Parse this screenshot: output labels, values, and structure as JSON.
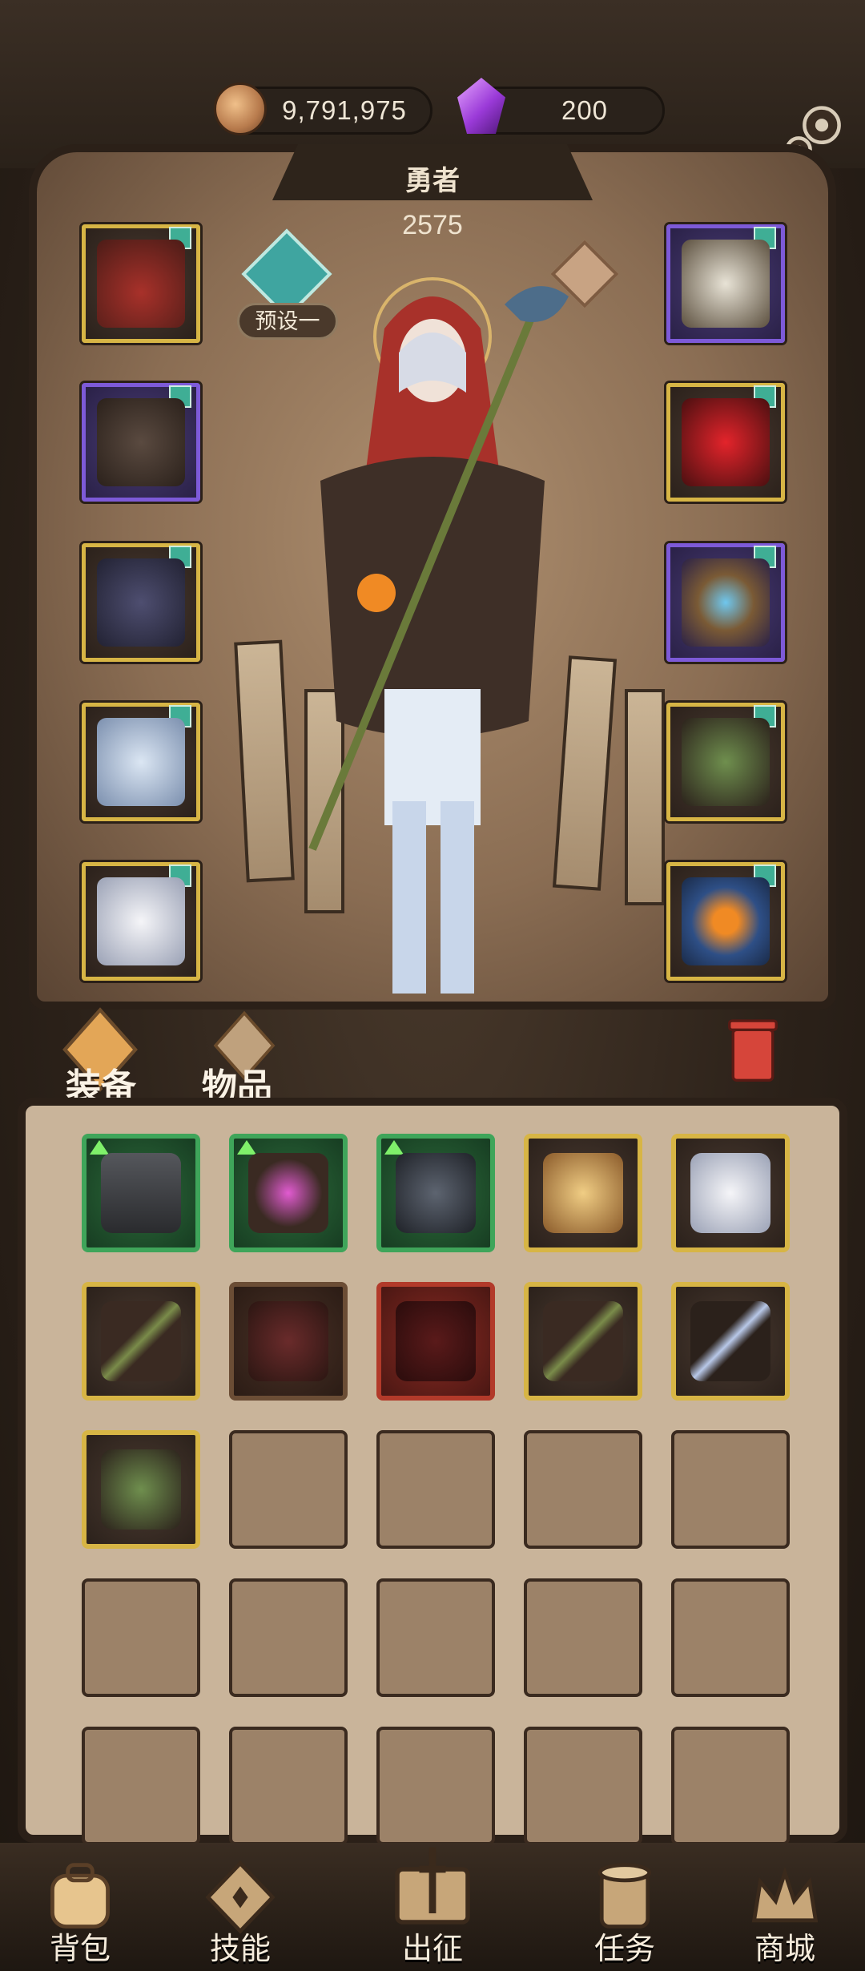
{
  "currency": {
    "gold": "9,791,975",
    "gems": "200"
  },
  "hero": {
    "name": "勇者",
    "power": "2575",
    "preset_label": "预设一"
  },
  "tabs": [
    {
      "label": "装备"
    },
    {
      "label": "物品"
    }
  ],
  "nav": [
    {
      "label": "背包",
      "icon": "backpack-icon"
    },
    {
      "label": "技能",
      "icon": "skill-book-icon"
    },
    {
      "label": "出征",
      "icon": "expedition-map-icon"
    },
    {
      "label": "任务",
      "icon": "quest-scroll-icon"
    },
    {
      "label": "商城",
      "icon": "shop-crown-icon"
    }
  ],
  "equipment_left": [
    {
      "name": "red-cloak-hood",
      "rarity": "gold"
    },
    {
      "name": "fur-mantle",
      "rarity": "purple"
    },
    {
      "name": "dark-gauntlet",
      "rarity": "gold"
    },
    {
      "name": "white-skirt",
      "rarity": "gold"
    },
    {
      "name": "winged-boots",
      "rarity": "gold"
    }
  ],
  "equipment_right": [
    {
      "name": "shield-amulet",
      "rarity": "purple"
    },
    {
      "name": "crimson-helm",
      "rarity": "gold"
    },
    {
      "name": "blue-gem-ring",
      "rarity": "purple"
    },
    {
      "name": "thorn-staff",
      "rarity": "gold"
    },
    {
      "name": "orb-tome",
      "rarity": "gold"
    }
  ],
  "bag": {
    "rows": [
      [
        {
          "type": "green",
          "name": "iron-pauldron",
          "up": true
        },
        {
          "type": "green",
          "name": "gem-scepter",
          "up": true
        },
        {
          "type": "green",
          "name": "wolf-helm",
          "up": true
        },
        {
          "type": "gold",
          "name": "golden-greaves"
        },
        {
          "type": "gold",
          "name": "winged-boots"
        }
      ],
      [
        {
          "type": "gold",
          "name": "thorn-wand"
        },
        {
          "type": "brown",
          "name": "leather-bracer"
        },
        {
          "type": "red",
          "name": "dark-rune-shield"
        },
        {
          "type": "gold",
          "name": "thorn-wand"
        },
        {
          "type": "gold",
          "name": "lightning-charm"
        }
      ],
      [
        {
          "type": "gold",
          "name": "thorn-staff"
        },
        {
          "type": "empty"
        },
        {
          "type": "empty"
        },
        {
          "type": "empty"
        },
        {
          "type": "empty"
        }
      ],
      [
        {
          "type": "empty"
        },
        {
          "type": "empty"
        },
        {
          "type": "empty"
        },
        {
          "type": "empty"
        },
        {
          "type": "empty"
        }
      ],
      [
        {
          "type": "empty"
        },
        {
          "type": "empty"
        },
        {
          "type": "empty"
        },
        {
          "type": "empty"
        },
        {
          "type": "empty"
        }
      ]
    ]
  },
  "colors": {
    "gold_frame": "#d7b545",
    "purple_frame": "#7d5ad8",
    "green_frame": "#3fa55a",
    "red_frame": "#b23a2a",
    "level_badge": "#3fae95"
  }
}
